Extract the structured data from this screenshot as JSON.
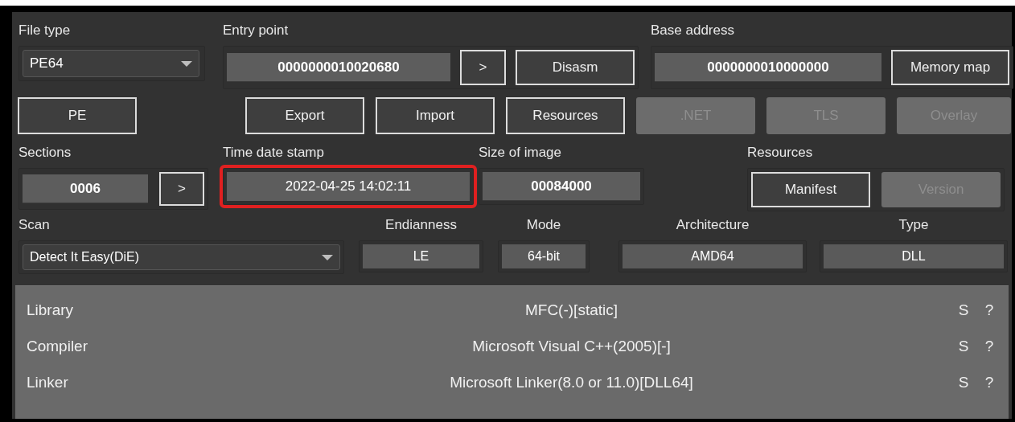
{
  "file_type": {
    "label": "File type",
    "value": "PE64"
  },
  "entry_point": {
    "label": "Entry point",
    "value": "0000000010020680",
    "buttons": [
      {
        "label": ">",
        "disabled": false
      },
      {
        "label": "Disasm",
        "disabled": false
      }
    ]
  },
  "base_address": {
    "label": "Base address",
    "value": "0000000010000000",
    "buttons": [
      {
        "label": "Memory map",
        "disabled": false
      }
    ]
  },
  "pe_button": {
    "label": "PE",
    "disabled": false
  },
  "info_buttons": [
    {
      "label": "Export",
      "disabled": false
    },
    {
      "label": "Import",
      "disabled": false
    },
    {
      "label": "Resources",
      "disabled": false
    },
    {
      "label": ".NET",
      "disabled": true
    },
    {
      "label": "TLS",
      "disabled": true
    },
    {
      "label": "Overlay",
      "disabled": true
    }
  ],
  "sections": {
    "label": "Sections",
    "value": "0006",
    "buttons": [
      {
        "label": ">",
        "disabled": false
      }
    ]
  },
  "time_date_stamp": {
    "label": "Time date stamp",
    "value": "2022-04-25 14:02:11",
    "highlighted": true
  },
  "size_of_image": {
    "label": "Size of image",
    "value": "00084000"
  },
  "resources": {
    "label": "Resources",
    "buttons": [
      {
        "label": "Manifest",
        "disabled": false
      },
      {
        "label": "Version",
        "disabled": true
      }
    ]
  },
  "scan": {
    "label": "Scan",
    "value": "Detect It Easy(DiE)"
  },
  "endianness": {
    "label": "Endianness",
    "value": "LE"
  },
  "mode": {
    "label": "Mode",
    "value": "64-bit"
  },
  "architecture": {
    "label": "Architecture",
    "value": "AMD64"
  },
  "type": {
    "label": "Type",
    "value": "DLL"
  },
  "results": [
    {
      "kind": "Library",
      "name": "MFC(-)[static]",
      "s": "S",
      "info": "?"
    },
    {
      "kind": "Compiler",
      "name": "Microsoft Visual C++(2005)[-]",
      "s": "S",
      "info": "?"
    },
    {
      "kind": "Linker",
      "name": "Microsoft Linker(8.0 or 11.0)[DLL64]",
      "s": "S",
      "info": "?"
    }
  ]
}
